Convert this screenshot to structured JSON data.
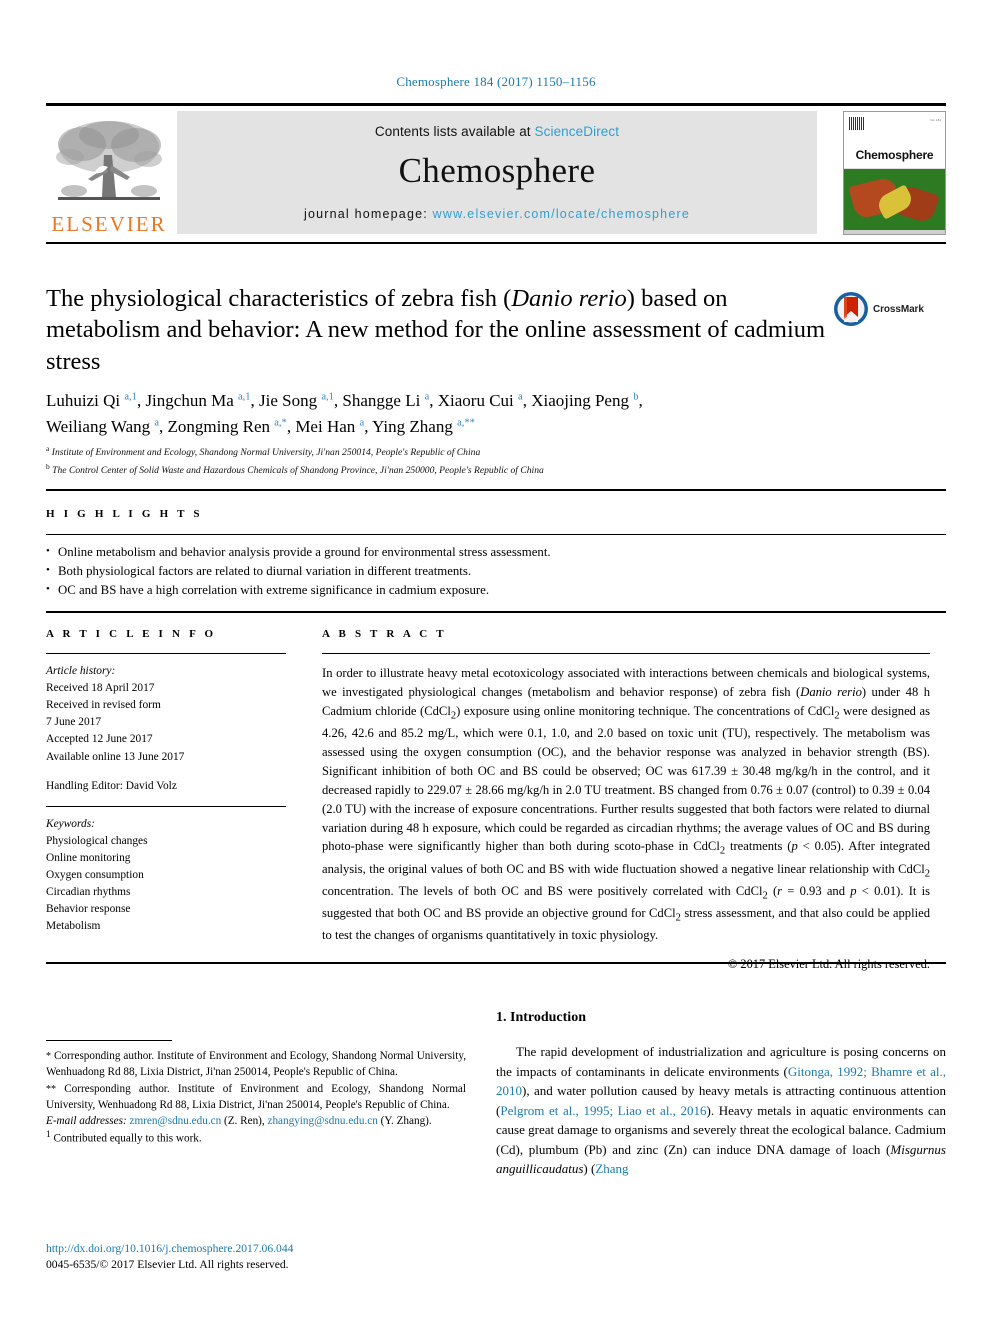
{
  "running_head": "Chemosphere 184 (2017) 1150–1156",
  "masthead": {
    "publisher_logo_text": "ELSEVIER",
    "contents_prefix": "Contents lists available at",
    "contents_link": "ScienceDirect",
    "journal_title": "Chemosphere",
    "homepage_label": "journal homepage:",
    "homepage_link": "www.elsevier.com/locate/chemosphere",
    "cover_title": "Chemosphere"
  },
  "crossmark": {
    "label": "CrossMark"
  },
  "article": {
    "title_part1": "The physiological characteristics of zebra fish (",
    "title_italic": "Danio rerio",
    "title_part2": ") based on metabolism and behavior: A new method for the online assessment of cadmium stress",
    "authors_line1": "Luhuizi Qi a,1, Jingchun Ma a,1, Jie Song a,1, Shangge Li a, Xiaoru Cui a, Xiaojing Peng b,",
    "authors_line2": "Weiliang Wang a, Zongming Ren a,*, Mei Han a, Ying Zhang a,**",
    "affiliation_a": "Institute of Environment and Ecology, Shandong Normal University, Ji'nan 250014, People's Republic of China",
    "affiliation_b": "The Control Center of Solid Waste and Hazardous Chemicals of Shandong Province, Ji'nan 250000, People's Republic of China"
  },
  "highlights": {
    "heading": "H I G H L I G H T S",
    "items": [
      "Online metabolism and behavior analysis provide a ground for environmental stress assessment.",
      "Both physiological factors are related to diurnal variation in different treatments.",
      "OC and BS have a high correlation with extreme significance in cadmium exposure."
    ]
  },
  "article_info": {
    "heading": "A R T I C L E   I N F O",
    "history_label": "Article history:",
    "history": [
      "Received 18 April 2017",
      "Received in revised form",
      "7 June 2017",
      "Accepted 12 June 2017",
      "Available online 13 June 2017"
    ],
    "handling_editor": "Handling Editor: David Volz",
    "keywords_label": "Keywords:",
    "keywords": [
      "Physiological changes",
      "Online monitoring",
      "Oxygen consumption",
      "Circadian rhythms",
      "Behavior response",
      "Metabolism"
    ]
  },
  "abstract": {
    "heading": "A B S T R A C T",
    "text": "In order to illustrate heavy metal ecotoxicology associated with interactions between chemicals and biological systems, we investigated physiological changes (metabolism and behavior response) of zebra fish (Danio rerio) under 48 h Cadmium chloride (CdCl2) exposure using online monitoring technique. The concentrations of CdCl2 were designed as 4.26, 42.6 and 85.2 mg/L, which were 0.1, 1.0, and 2.0 based on toxic unit (TU), respectively. The metabolism was assessed using the oxygen consumption (OC), and the behavior response was analyzed in behavior strength (BS). Significant inhibition of both OC and BS could be observed; OC was 617.39 ± 30.48 mg/kg/h in the control, and it decreased rapidly to 229.07 ± 28.66 mg/kg/h in 2.0 TU treatment. BS changed from 0.76 ± 0.07 (control) to 0.39 ± 0.04 (2.0 TU) with the increase of exposure concentrations. Further results suggested that both factors were related to diurnal variation during 48 h exposure, which could be regarded as circadian rhythms; the average values of OC and BS during photo-phase were significantly higher than both during scoto-phase in CdCl2 treatments (p < 0.05). After integrated analysis, the original values of both OC and BS with wide fluctuation showed a negative linear relationship with CdCl2 concentration. The levels of both OC and BS were positively correlated with CdCl2 (r = 0.93 and p < 0.01). It is suggested that both OC and BS provide an objective ground for CdCl2 stress assessment, and that also could be applied to test the changes of organisms quantitatively in toxic physiology.",
    "copyright": "© 2017 Elsevier Ltd. All rights reserved."
  },
  "footnotes": {
    "corresponding_1": "Corresponding author. Institute of Environment and Ecology, Shandong Normal University, Wenhuadong Rd 88, Lixia District, Ji'nan 250014, People's Republic of China.",
    "corresponding_2": "Corresponding author. Institute of Environment and Ecology, Shandong Normal University, Wenhuadong Rd 88, Lixia District, Ji'nan 250014, People's Republic of China.",
    "email_label": "E-mail addresses:",
    "email_1": "zmren@sdnu.edu.cn",
    "email_1_attr": "(Z. Ren),",
    "email_2": "zhangying@sdnu.edu.cn",
    "email_2_attr": "(Y. Zhang).",
    "equal_contrib": "Contributed equally to this work."
  },
  "footer": {
    "doi": "http://dx.doi.org/10.1016/j.chemosphere.2017.06.044",
    "issn_line": "0045-6535/© 2017 Elsevier Ltd. All rights reserved."
  },
  "introduction": {
    "heading": "1. Introduction",
    "p1_a": "The rapid development of industrialization and agriculture is posing concerns on the impacts of contaminants in delicate environments (",
    "ref1": "Gitonga, 1992; Bhamre et al., 2010",
    "p1_b": "), and water pollution caused by heavy metals is attracting continuous attention (",
    "ref2": "Pelgrom et al., 1995; Liao et al., 2016",
    "p1_c": "). Heavy metals in aquatic environments can cause great damage to organisms and severely threat the ecological balance. Cadmium (Cd), plumbum (Pb) and zinc (Zn) can induce DNA damage of loach (",
    "p1_italic": "Misgurnus anguillicaudatus",
    "p1_d": ") (",
    "ref3": "Zhang"
  },
  "colors": {
    "link": "#1a7aad",
    "science_direct": "#2f9fd0",
    "elsevier_orange": "#e87722",
    "banner_bg": "#e3e3e3"
  }
}
